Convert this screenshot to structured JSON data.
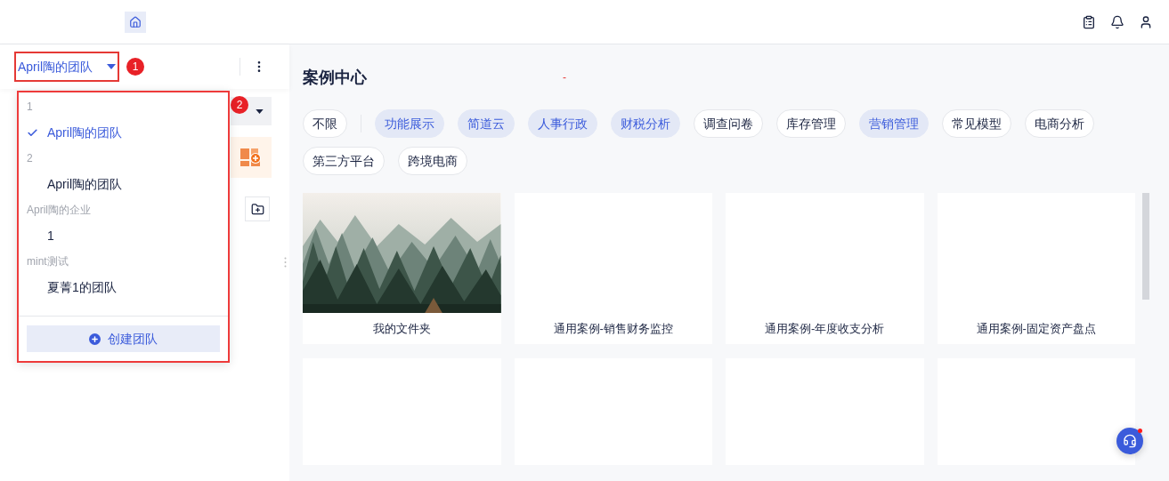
{
  "team_selector": {
    "label": "April陶的团队"
  },
  "annotations": [
    "1",
    "2"
  ],
  "team_dropdown": {
    "groups": [
      {
        "heading": "1",
        "teams": [
          {
            "name": "April陶的团队",
            "selected": true
          }
        ]
      },
      {
        "heading": "2",
        "teams": [
          {
            "name": "April陶的团队",
            "selected": false
          }
        ]
      },
      {
        "heading": "April陶的企业",
        "teams": [
          {
            "name": "1",
            "selected": false
          }
        ]
      },
      {
        "heading": "mint测试",
        "teams": [
          {
            "name": "夏菁1的团队",
            "selected": false
          }
        ]
      }
    ],
    "create_button": "创建团队"
  },
  "page_title": "案例中心",
  "dash": "-",
  "filters": {
    "all_option": "不限",
    "tags": [
      {
        "label": "功能展示",
        "selected": true
      },
      {
        "label": "简道云",
        "selected": true
      },
      {
        "label": "人事行政",
        "selected": true
      },
      {
        "label": "财税分析",
        "selected": true
      },
      {
        "label": "调查问卷",
        "selected": false
      },
      {
        "label": "库存管理",
        "selected": false
      },
      {
        "label": "营销管理",
        "selected": true
      },
      {
        "label": "常见模型",
        "selected": false
      },
      {
        "label": "电商分析",
        "selected": false
      },
      {
        "label": "第三方平台",
        "selected": false
      },
      {
        "label": "跨境电商",
        "selected": false
      }
    ]
  },
  "cards": [
    {
      "kind": "picture",
      "caption": "我的文件夹"
    },
    {
      "kind": "blank",
      "caption": "通用案例-销售财务监控"
    },
    {
      "kind": "blank",
      "caption": "通用案例-年度收支分析"
    },
    {
      "kind": "blank",
      "caption": "通用案例-固定资产盘点"
    },
    {
      "kind": "blank"
    },
    {
      "kind": "blank"
    },
    {
      "kind": "blank"
    },
    {
      "kind": "blank"
    }
  ]
}
